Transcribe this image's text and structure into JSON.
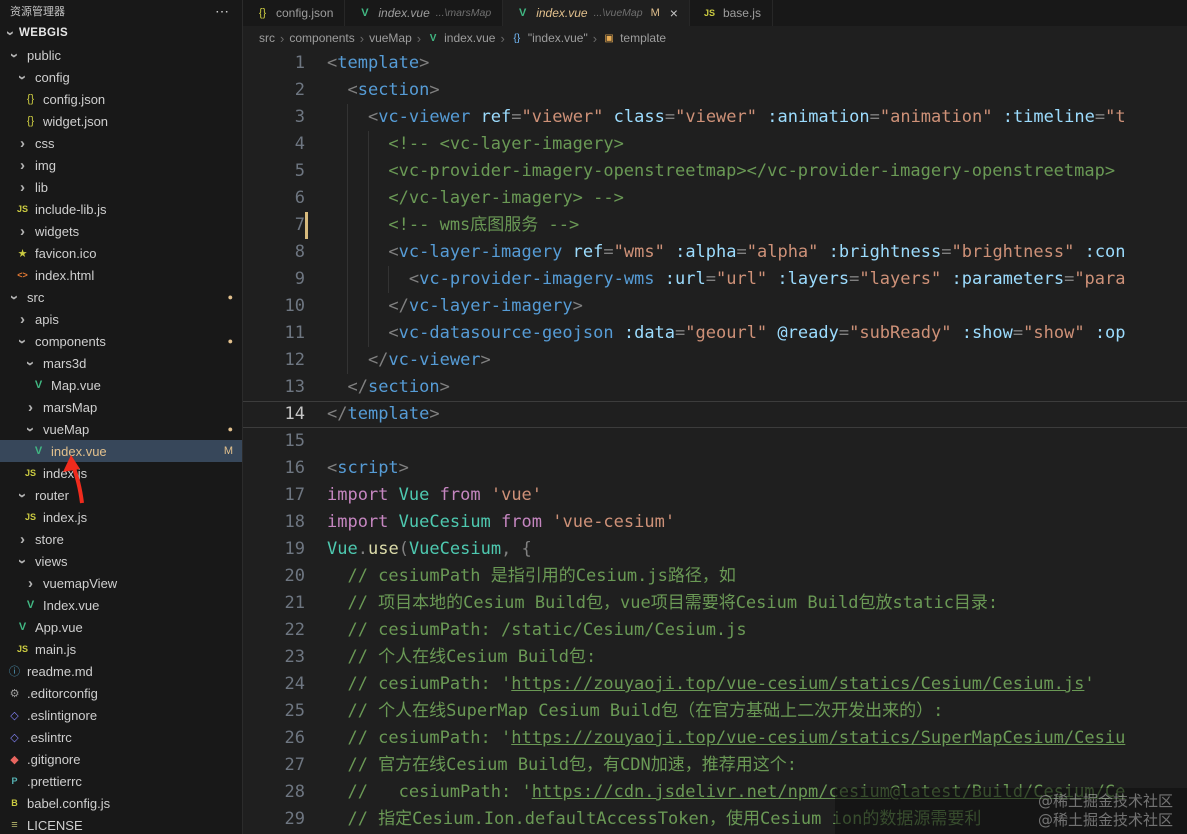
{
  "colors": {
    "git_modified": "#e2c08d",
    "vue_green": "#41b883",
    "js_yellow": "#cbcb41",
    "selection": "#37475a"
  },
  "sidebar": {
    "header": "资源管理器",
    "header_actions": "⋯",
    "section": "WEBGIS",
    "tree": [
      {
        "label": "public",
        "icon": "chevron-down-icon",
        "indent": 0
      },
      {
        "label": "config",
        "icon": "chevron-down-icon",
        "indent": 1
      },
      {
        "label": "config.json",
        "icon": "json-icon",
        "indent": 2
      },
      {
        "label": "widget.json",
        "icon": "json-icon",
        "indent": 2
      },
      {
        "label": "css",
        "icon": "chevron-right-icon",
        "indent": 1
      },
      {
        "label": "img",
        "icon": "chevron-right-icon",
        "indent": 1
      },
      {
        "label": "lib",
        "icon": "chevron-right-icon",
        "indent": 1
      },
      {
        "label": "include-lib.js",
        "icon": "js-icon",
        "indent": 1
      },
      {
        "label": "widgets",
        "icon": "chevron-right-icon",
        "indent": 1
      },
      {
        "label": "favicon.ico",
        "icon": "star-icon",
        "indent": 1
      },
      {
        "label": "index.html",
        "icon": "html-icon",
        "indent": 1
      },
      {
        "label": "src",
        "icon": "chevron-down-icon",
        "indent": 0,
        "badge": "dot"
      },
      {
        "label": "apis",
        "icon": "chevron-right-icon",
        "indent": 1
      },
      {
        "label": "components",
        "icon": "chevron-down-icon",
        "indent": 1,
        "badge": "dot"
      },
      {
        "label": "mars3d",
        "icon": "chevron-down-icon",
        "indent": 2
      },
      {
        "label": "Map.vue",
        "icon": "vue-icon",
        "indent": 3
      },
      {
        "label": "marsMap",
        "icon": "chevron-right-icon",
        "indent": 2
      },
      {
        "label": "vueMap",
        "icon": "chevron-down-icon",
        "indent": 2,
        "badge": "dot"
      },
      {
        "label": "index.vue",
        "icon": "vue-icon",
        "indent": 3,
        "badge": "M",
        "selected": true,
        "modified": true
      },
      {
        "label": "index.js",
        "icon": "js-icon",
        "indent": 2
      },
      {
        "label": "router",
        "icon": "chevron-down-icon",
        "indent": 1
      },
      {
        "label": "index.js",
        "icon": "js-icon",
        "indent": 2
      },
      {
        "label": "store",
        "icon": "chevron-right-icon",
        "indent": 1
      },
      {
        "label": "views",
        "icon": "chevron-down-icon",
        "indent": 1
      },
      {
        "label": "vuemapView",
        "icon": "chevron-right-icon",
        "indent": 2
      },
      {
        "label": "Index.vue",
        "icon": "vue-icon",
        "indent": 2
      },
      {
        "label": "App.vue",
        "icon": "vue-icon",
        "indent": 1
      },
      {
        "label": "main.js",
        "icon": "js-icon",
        "indent": 1
      },
      {
        "label": "readme.md",
        "icon": "info-icon",
        "indent": 0
      },
      {
        "label": ".editorconfig",
        "icon": "gear-icon",
        "indent": 0
      },
      {
        "label": ".eslintignore",
        "icon": "eslint-icon",
        "indent": 0
      },
      {
        "label": ".eslintrc",
        "icon": "eslint-icon",
        "indent": 0
      },
      {
        "label": ".gitignore",
        "icon": "git-icon",
        "indent": 0
      },
      {
        "label": ".prettierrc",
        "icon": "prettier-icon",
        "indent": 0
      },
      {
        "label": "babel.config.js",
        "icon": "babel-icon",
        "indent": 0
      },
      {
        "label": "LICENSE",
        "icon": "certificate-icon",
        "indent": 0
      }
    ]
  },
  "tabs": [
    {
      "label": "config.json",
      "icon": "json-icon",
      "active": false,
      "italic": false
    },
    {
      "label": "index.vue",
      "path_hint": "...\\marsMap",
      "icon": "vue-icon",
      "active": false,
      "italic": true
    },
    {
      "label": "index.vue",
      "path_hint": "...\\vueMap",
      "icon": "vue-icon",
      "active": true,
      "italic": true,
      "git_badge": "M",
      "close_label": "×"
    },
    {
      "label": "base.js",
      "icon": "js-icon",
      "active": false,
      "italic": false
    }
  ],
  "breadcrumb": {
    "separator": "›",
    "items": [
      {
        "label": "src"
      },
      {
        "label": "components"
      },
      {
        "label": "vueMap"
      },
      {
        "label": "index.vue",
        "icon": "vue-icon"
      },
      {
        "label": "\"index.vue\"",
        "icon": "braces-icon"
      },
      {
        "label": "template",
        "icon": "symbol-icon"
      }
    ]
  },
  "editor": {
    "current_line": 14,
    "gutter_marker_line": 7,
    "lines": [
      {
        "n": 1,
        "indent": 0,
        "tokens": [
          [
            "<",
            "p"
          ],
          [
            "template",
            "tag"
          ],
          [
            ">",
            "p"
          ]
        ]
      },
      {
        "n": 2,
        "indent": 2,
        "tokens": [
          [
            "<",
            "p"
          ],
          [
            "section",
            "tag"
          ],
          [
            ">",
            "p"
          ]
        ]
      },
      {
        "n": 3,
        "indent": 4,
        "tokens": [
          [
            "<",
            "p"
          ],
          [
            "vc-viewer",
            "tag"
          ],
          [
            " ",
            "pl"
          ],
          [
            "ref",
            "attr"
          ],
          [
            "=",
            "p"
          ],
          [
            "\"viewer\"",
            "str"
          ],
          [
            " ",
            "pl"
          ],
          [
            "class",
            "attr"
          ],
          [
            "=",
            "p"
          ],
          [
            "\"viewer\"",
            "str"
          ],
          [
            " ",
            "pl"
          ],
          [
            ":animation",
            "attr"
          ],
          [
            "=",
            "p"
          ],
          [
            "\"animation\"",
            "str"
          ],
          [
            " ",
            "pl"
          ],
          [
            ":timeline",
            "attr"
          ],
          [
            "=",
            "p"
          ],
          [
            "\"t",
            "str"
          ]
        ]
      },
      {
        "n": 4,
        "indent": 6,
        "tokens": [
          [
            "<!-- <vc-layer-imagery>",
            "com"
          ]
        ]
      },
      {
        "n": 5,
        "indent": 6,
        "tokens": [
          [
            "<vc-provider-imagery-openstreetmap></vc-provider-imagery-openstreetmap>",
            "com"
          ]
        ]
      },
      {
        "n": 6,
        "indent": 6,
        "tokens": [
          [
            "</vc-layer-imagery> -->",
            "com"
          ]
        ]
      },
      {
        "n": 7,
        "indent": 6,
        "tokens": [
          [
            "<!-- wms底图服务 -->",
            "com"
          ]
        ]
      },
      {
        "n": 8,
        "indent": 6,
        "tokens": [
          [
            "<",
            "p"
          ],
          [
            "vc-layer-imagery",
            "tag"
          ],
          [
            " ",
            "pl"
          ],
          [
            "ref",
            "attr"
          ],
          [
            "=",
            "p"
          ],
          [
            "\"wms\"",
            "str"
          ],
          [
            " ",
            "pl"
          ],
          [
            ":alpha",
            "attr"
          ],
          [
            "=",
            "p"
          ],
          [
            "\"alpha\"",
            "str"
          ],
          [
            " ",
            "pl"
          ],
          [
            ":brightness",
            "attr"
          ],
          [
            "=",
            "p"
          ],
          [
            "\"brightness\"",
            "str"
          ],
          [
            " ",
            "pl"
          ],
          [
            ":con",
            "attr"
          ]
        ]
      },
      {
        "n": 9,
        "indent": 8,
        "tokens": [
          [
            "<",
            "p"
          ],
          [
            "vc-provider-imagery-wms",
            "tag"
          ],
          [
            " ",
            "pl"
          ],
          [
            ":url",
            "attr"
          ],
          [
            "=",
            "p"
          ],
          [
            "\"url\"",
            "str"
          ],
          [
            " ",
            "pl"
          ],
          [
            ":layers",
            "attr"
          ],
          [
            "=",
            "p"
          ],
          [
            "\"layers\"",
            "str"
          ],
          [
            " ",
            "pl"
          ],
          [
            ":parameters",
            "attr"
          ],
          [
            "=",
            "p"
          ],
          [
            "\"para",
            "str"
          ]
        ]
      },
      {
        "n": 10,
        "indent": 6,
        "tokens": [
          [
            "</",
            "p"
          ],
          [
            "vc-layer-imagery",
            "tag"
          ],
          [
            ">",
            "p"
          ]
        ]
      },
      {
        "n": 11,
        "indent": 6,
        "tokens": [
          [
            "<",
            "p"
          ],
          [
            "vc-datasource-geojson",
            "tag"
          ],
          [
            " ",
            "pl"
          ],
          [
            ":data",
            "attr"
          ],
          [
            "=",
            "p"
          ],
          [
            "\"geourl\"",
            "str"
          ],
          [
            " ",
            "pl"
          ],
          [
            "@ready",
            "attr"
          ],
          [
            "=",
            "p"
          ],
          [
            "\"subReady\"",
            "str"
          ],
          [
            " ",
            "pl"
          ],
          [
            ":show",
            "attr"
          ],
          [
            "=",
            "p"
          ],
          [
            "\"show\"",
            "str"
          ],
          [
            " ",
            "pl"
          ],
          [
            ":op",
            "attr"
          ]
        ]
      },
      {
        "n": 12,
        "indent": 4,
        "tokens": [
          [
            "</",
            "p"
          ],
          [
            "vc-viewer",
            "tag"
          ],
          [
            ">",
            "p"
          ]
        ]
      },
      {
        "n": 13,
        "indent": 2,
        "tokens": [
          [
            "</",
            "p"
          ],
          [
            "section",
            "tag"
          ],
          [
            ">",
            "p"
          ]
        ]
      },
      {
        "n": 14,
        "indent": 0,
        "tokens": [
          [
            "</",
            "p"
          ],
          [
            "template",
            "tag"
          ],
          [
            ">",
            "p"
          ]
        ]
      },
      {
        "n": 15,
        "indent": 0,
        "tokens": []
      },
      {
        "n": 16,
        "indent": 0,
        "tokens": [
          [
            "<",
            "p"
          ],
          [
            "script",
            "tag"
          ],
          [
            ">",
            "p"
          ]
        ]
      },
      {
        "n": 17,
        "indent": 0,
        "tokens": [
          [
            "import",
            "kw"
          ],
          [
            " ",
            "pl"
          ],
          [
            "Vue",
            "cls"
          ],
          [
            " ",
            "pl"
          ],
          [
            "from",
            "kw"
          ],
          [
            " ",
            "pl"
          ],
          [
            "'vue'",
            "str"
          ]
        ]
      },
      {
        "n": 18,
        "indent": 0,
        "tokens": [
          [
            "import",
            "kw"
          ],
          [
            " ",
            "pl"
          ],
          [
            "VueCesium",
            "cls"
          ],
          [
            " ",
            "pl"
          ],
          [
            "from",
            "kw"
          ],
          [
            " ",
            "pl"
          ],
          [
            "'vue-cesium'",
            "str"
          ]
        ]
      },
      {
        "n": 19,
        "indent": 0,
        "tokens": [
          [
            "Vue",
            "cls"
          ],
          [
            ".",
            "p"
          ],
          [
            "use",
            "fn"
          ],
          [
            "(",
            "p"
          ],
          [
            "VueCesium",
            "cls"
          ],
          [
            ", {",
            "p"
          ]
        ]
      },
      {
        "n": 20,
        "indent": 2,
        "tokens": [
          [
            "// cesiumPath 是指引用的Cesium.js路径，如",
            "com"
          ]
        ]
      },
      {
        "n": 21,
        "indent": 2,
        "tokens": [
          [
            "// 项目本地的Cesium Build包，vue项目需要将Cesium Build包放static目录:",
            "com"
          ]
        ]
      },
      {
        "n": 22,
        "indent": 2,
        "tokens": [
          [
            "// cesiumPath: /static/Cesium/Cesium.js",
            "com"
          ]
        ]
      },
      {
        "n": 23,
        "indent": 2,
        "tokens": [
          [
            "// 个人在线Cesium Build包:",
            "com"
          ]
        ]
      },
      {
        "n": 24,
        "indent": 2,
        "tokens": [
          [
            "// cesiumPath: '",
            "com"
          ],
          [
            "https://zouyaoji.top/vue-cesium/statics/Cesium/Cesium.js",
            "lnk"
          ],
          [
            "'",
            "com"
          ]
        ]
      },
      {
        "n": 25,
        "indent": 2,
        "tokens": [
          [
            "// 个人在线SuperMap Cesium Build包（在官方基础上二次开发出来的）:",
            "com"
          ]
        ]
      },
      {
        "n": 26,
        "indent": 2,
        "tokens": [
          [
            "// cesiumPath: '",
            "com"
          ],
          [
            "https://zouyaoji.top/vue-cesium/statics/SuperMapCesium/Cesiu",
            "lnk"
          ]
        ]
      },
      {
        "n": 27,
        "indent": 2,
        "tokens": [
          [
            "// 官方在线Cesium Build包，有CDN加速，推荐用这个:",
            "com"
          ]
        ]
      },
      {
        "n": 28,
        "indent": 2,
        "tokens": [
          [
            "//   cesiumPath: '",
            "com"
          ],
          [
            "https://cdn.jsdelivr.net/npm/cesium@latest/Build/Cesium/Ce",
            "lnk"
          ]
        ]
      },
      {
        "n": 29,
        "indent": 2,
        "tokens": [
          [
            "// 指定Cesium.Ion.defaultAccessToken，使用Cesium ion的数据源需要利",
            "com"
          ]
        ]
      }
    ]
  },
  "annotations": {
    "watermark_line1": "@稀土掘金技术社区",
    "watermark_line2": "@稀土掘金技术社区"
  }
}
